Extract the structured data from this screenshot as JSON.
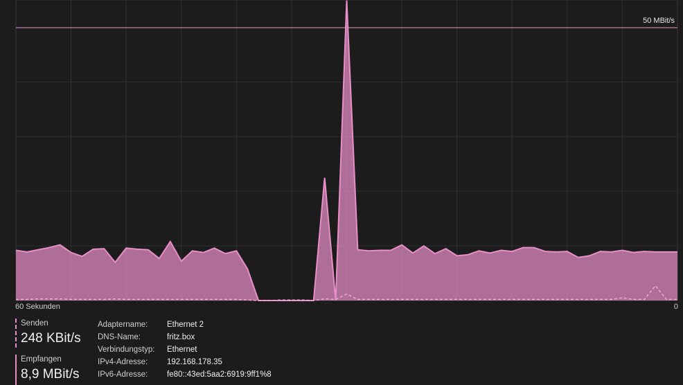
{
  "chart": {
    "max_label": "50 MBit/s",
    "x_left_label": "60 Sekunden",
    "x_right_label": "0"
  },
  "chart_data": {
    "type": "area",
    "ylim": [
      0,
      50
    ],
    "x": [
      60,
      59,
      58,
      57,
      56,
      55,
      54,
      53,
      52,
      51,
      50,
      49,
      48,
      47,
      46,
      45,
      44,
      43,
      42,
      41,
      40,
      39,
      38,
      37,
      36,
      35,
      34,
      33,
      32,
      31,
      30,
      29,
      28,
      27,
      26,
      25,
      24,
      23,
      22,
      21,
      20,
      19,
      18,
      17,
      16,
      15,
      14,
      13,
      12,
      11,
      10,
      9,
      8,
      7,
      6,
      5,
      4,
      3,
      2,
      1,
      0
    ],
    "series": [
      {
        "name": "Empfangen",
        "style": "solid",
        "values": [
          9.2,
          8.9,
          9.3,
          9.7,
          10.2,
          8.8,
          8.1,
          9.4,
          9.5,
          7.0,
          9.6,
          9.4,
          9.3,
          7.7,
          10.8,
          7.2,
          9.1,
          8.8,
          9.6,
          8.6,
          9.1,
          5.8,
          0,
          0,
          0,
          0,
          0,
          0,
          22.5,
          0,
          55,
          9.3,
          9.1,
          9.2,
          9.2,
          10.2,
          8.7,
          10.0,
          8.6,
          9.5,
          8.2,
          8.4,
          9.1,
          8.7,
          9.2,
          9.0,
          9.7,
          9.7,
          9.0,
          8.9,
          9.0,
          7.9,
          8.2,
          9.0,
          8.9,
          9.2,
          8.8,
          9.0,
          8.9,
          8.9,
          8.9
        ],
        "color": "#e88fc8"
      },
      {
        "name": "Senden",
        "style": "dashed",
        "values": [
          0.2,
          0.2,
          0.3,
          0.3,
          0.3,
          0.2,
          0.2,
          0.2,
          0.2,
          0.3,
          0.2,
          0.2,
          0.2,
          0.2,
          0.2,
          0.2,
          0.2,
          0.2,
          0.2,
          0.2,
          0.2,
          0.1,
          0,
          0,
          0.1,
          0.1,
          0.1,
          0,
          0.3,
          0.2,
          1.2,
          0.2,
          0.2,
          0.2,
          0.2,
          0.2,
          0.2,
          0.2,
          0.2,
          0.2,
          0.2,
          0.2,
          0.2,
          0.2,
          0.2,
          0.2,
          0.2,
          0.2,
          0.2,
          0.2,
          0.2,
          0.2,
          0.2,
          0.2,
          0.2,
          0.5,
          0.2,
          0.2,
          2.7,
          0.2,
          0.2
        ],
        "color": "#e88fc8"
      }
    ],
    "grid": true
  },
  "stats": {
    "send_label": "Senden",
    "send_value": "248 KBit/s",
    "recv_label": "Empfangen",
    "recv_value": "8,9 MBit/s"
  },
  "info": {
    "rows": [
      {
        "key": "Adaptername:",
        "value": "Ethernet 2"
      },
      {
        "key": "DNS-Name:",
        "value": "fritz.box"
      },
      {
        "key": "Verbindungstyp:",
        "value": "Ethernet"
      },
      {
        "key": "IPv4-Adresse:",
        "value": "192.168.178.35"
      },
      {
        "key": "IPv6-Adresse:",
        "value": "fe80::43ed:5aa2:6919:9ff1%8"
      }
    ]
  }
}
